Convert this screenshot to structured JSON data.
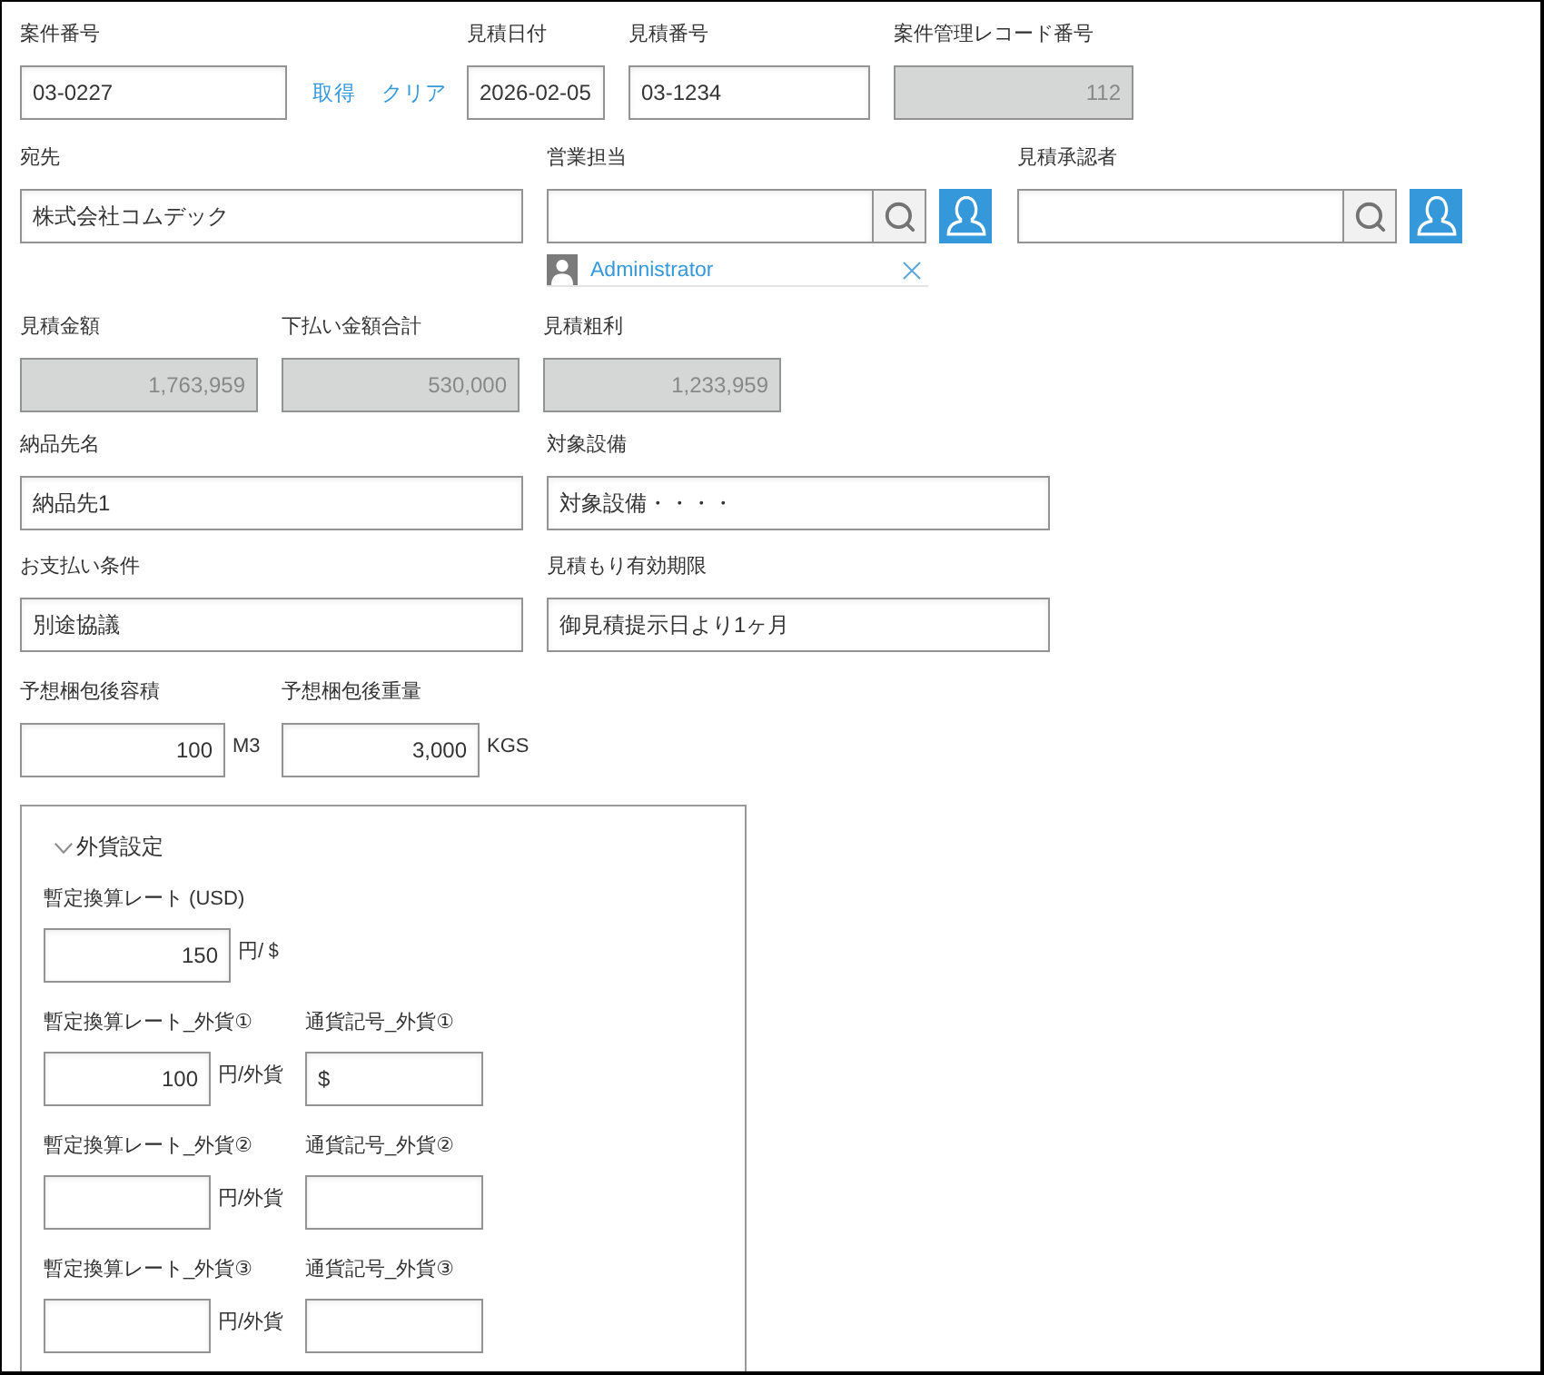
{
  "form": {
    "rows": [
      {
        "fields": [
          {
            "kind": "text",
            "label": "案件番号",
            "value": "03-0227",
            "actions": [
              "取得",
              "クリア"
            ]
          },
          {
            "kind": "text",
            "label": "見積日付",
            "value": "2026-02-05"
          },
          {
            "kind": "text",
            "label": "見積番号",
            "value": "03-1234"
          },
          {
            "kind": "readonly",
            "label": "案件管理レコード番号",
            "value": "112"
          }
        ]
      },
      {
        "fields": [
          {
            "kind": "text",
            "label": "宛先",
            "value": "株式会社コムデック"
          },
          {
            "kind": "user",
            "label": "営業担当",
            "selected_users": [
              "Administrator"
            ]
          },
          {
            "kind": "user",
            "label": "見積承認者"
          }
        ]
      },
      {
        "fields": [
          {
            "kind": "readonly",
            "label": "見積金額",
            "value": "1,763,959"
          },
          {
            "kind": "readonly",
            "label": "下払い金額合計",
            "value": "530,000"
          },
          {
            "kind": "readonly",
            "label": "見積粗利",
            "value": "1,233,959"
          }
        ]
      },
      {
        "fields": [
          {
            "kind": "text",
            "label": "納品先名",
            "value": "納品先1"
          },
          {
            "kind": "text",
            "label": "対象設備",
            "value": "対象設備・・・・"
          }
        ]
      },
      {
        "fields": [
          {
            "kind": "text",
            "label": "お支払い条件",
            "value": "別途協議"
          },
          {
            "kind": "text",
            "label": "見積もり有効期限",
            "value": "御見積提示日より1ヶ月"
          }
        ]
      },
      {
        "fields": [
          {
            "kind": "number",
            "label": "予想梱包後容積",
            "value": "100",
            "unit": "M3"
          },
          {
            "kind": "number",
            "label": "予想梱包後重量",
            "value": "3,000",
            "unit": "KGS"
          }
        ]
      }
    ],
    "group": {
      "title": "外貨設定",
      "expanded": true,
      "rows": [
        {
          "fields": [
            {
              "kind": "number",
              "label": "暫定換算レート (USD)",
              "value": "150",
              "unit": "円/＄"
            }
          ]
        },
        {
          "fields": [
            {
              "kind": "number",
              "label": "暫定換算レート_外貨①",
              "value": "100",
              "unit": "円/外貨"
            },
            {
              "kind": "text",
              "label": "通貨記号_外貨①",
              "value": "$"
            }
          ]
        },
        {
          "fields": [
            {
              "kind": "number",
              "label": "暫定換算レート_外貨②",
              "unit": "円/外貨"
            },
            {
              "kind": "text",
              "label": "通貨記号_外貨②"
            }
          ]
        },
        {
          "fields": [
            {
              "kind": "number",
              "label": "暫定換算レート_外貨③",
              "unit": "円/外貨"
            },
            {
              "kind": "text",
              "label": "通貨記号_外貨③"
            }
          ]
        }
      ]
    }
  }
}
